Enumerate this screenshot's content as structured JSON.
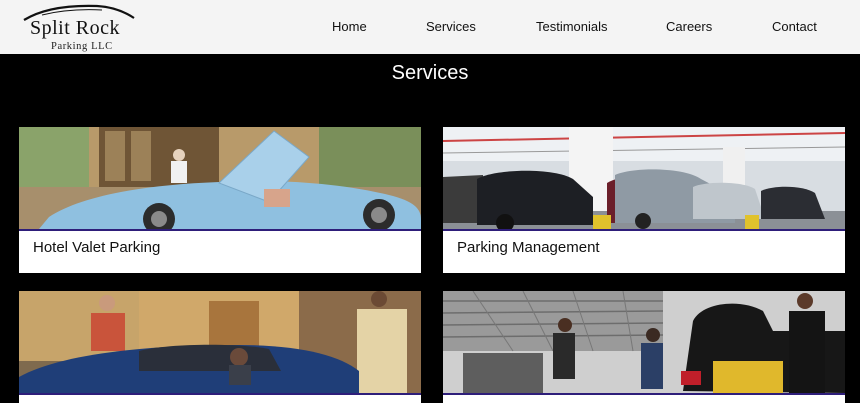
{
  "logo": {
    "line1": "Split Rock",
    "line2": "Parking LLC"
  },
  "nav": {
    "items": [
      "Home",
      "Services",
      "Testimonials",
      "Careers",
      "Contact"
    ]
  },
  "main": {
    "title": "Services",
    "cards": [
      {
        "label": "Hotel Valet Parking"
      },
      {
        "label": "Parking Management"
      },
      {
        "label": ""
      },
      {
        "label": ""
      }
    ]
  }
}
